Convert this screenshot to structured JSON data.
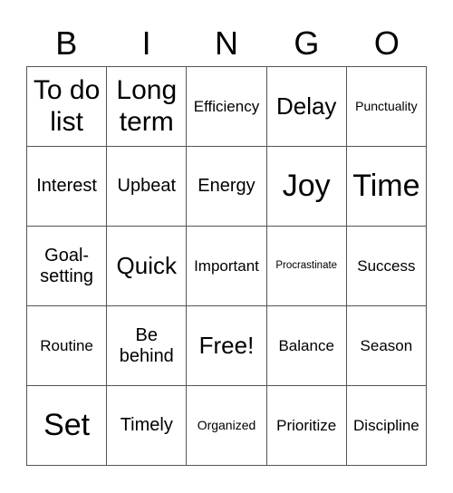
{
  "header": [
    "B",
    "I",
    "N",
    "G",
    "O"
  ],
  "cells": [
    [
      "To do list",
      "Long term",
      "Efficiency",
      "Delay",
      "Punctuality"
    ],
    [
      "Interest",
      "Upbeat",
      "Energy",
      "Joy",
      "Time"
    ],
    [
      "Goal-setting",
      "Quick",
      "Important",
      "Procrastinate",
      "Success"
    ],
    [
      "Routine",
      "Be behind",
      "Free!",
      "Balance",
      "Season"
    ],
    [
      "Set",
      "Timely",
      "Organized",
      "Prioritize",
      "Discipline"
    ]
  ],
  "display": {
    "r0": [
      "To do\nlist",
      "Long\nterm"
    ],
    "r2": [
      "Goal-\nsetting"
    ],
    "r3": [
      "Be\nbehind"
    ]
  }
}
